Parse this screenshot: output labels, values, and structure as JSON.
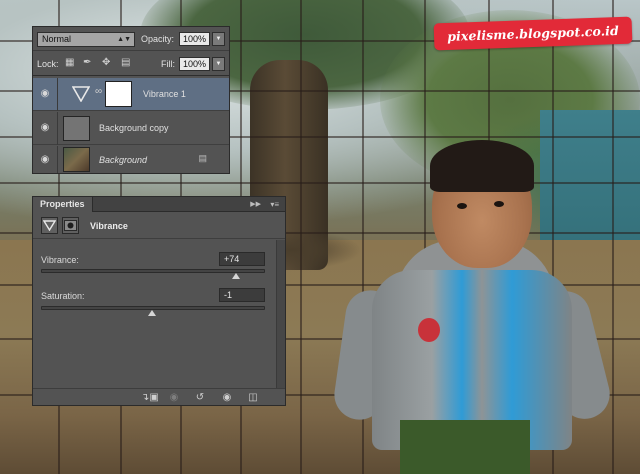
{
  "watermark": {
    "text": "pixelisme.blogspot.co.id"
  },
  "layers_panel": {
    "blend_mode": "Normal",
    "opacity_label": "Opacity:",
    "opacity_value": "100%",
    "lock_label": "Lock:",
    "fill_label": "Fill:",
    "fill_value": "100%",
    "layers": [
      {
        "name": "Vibrance 1",
        "selected": true,
        "visible": true,
        "type": "adjustment"
      },
      {
        "name": "Background copy",
        "selected": false,
        "visible": true,
        "type": "pixel"
      },
      {
        "name": "Background",
        "selected": false,
        "visible": true,
        "type": "locked-background"
      }
    ]
  },
  "properties_panel": {
    "tab_label": "Properties",
    "title": "Vibrance",
    "vibrance_label": "Vibrance:",
    "vibrance_value": "+74",
    "vibrance_number": 74,
    "saturation_label": "Saturation:",
    "saturation_value": "-1",
    "saturation_number": -1,
    "slider_min": -100,
    "slider_max": 100
  },
  "colors": {
    "panel_bg": "#535353",
    "selected_layer": "#5f6f84",
    "watermark_red": "#e22a38"
  }
}
